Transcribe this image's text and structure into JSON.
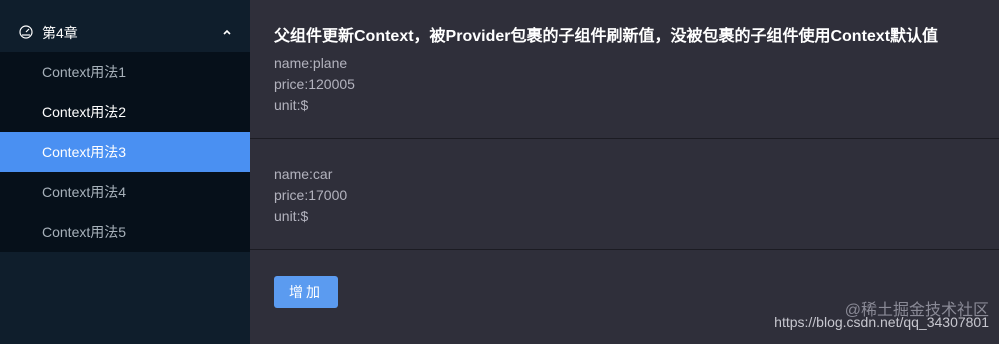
{
  "sidebar": {
    "group_label": "第4章",
    "items": [
      {
        "label": "Context用法1"
      },
      {
        "label": "Context用法2"
      },
      {
        "label": "Context用法3"
      },
      {
        "label": "Context用法4"
      },
      {
        "label": "Context用法5"
      }
    ]
  },
  "main": {
    "title": "父组件更新Context，被Provider包裹的子组件刷新值，没被包裹的子组件使用Context默认值",
    "blocks": [
      {
        "name": "name:plane",
        "price": "price:120005",
        "unit": "unit:$"
      },
      {
        "name": "name:car",
        "price": "price:17000",
        "unit": "unit:$"
      }
    ],
    "button_label": "增加"
  },
  "watermark": {
    "text": "https://blog.csdn.net/qq_34307801",
    "overlay": "@稀土掘金技术社区"
  },
  "colors": {
    "accent": "#4a90f2",
    "sidebar_bg": "#0f1e2c",
    "submenu_bg": "#06101a",
    "content_bg": "#2f2f3a"
  },
  "icons": {
    "group_icon": "dashboard-icon",
    "group_chevron": "chevron-up-icon"
  }
}
